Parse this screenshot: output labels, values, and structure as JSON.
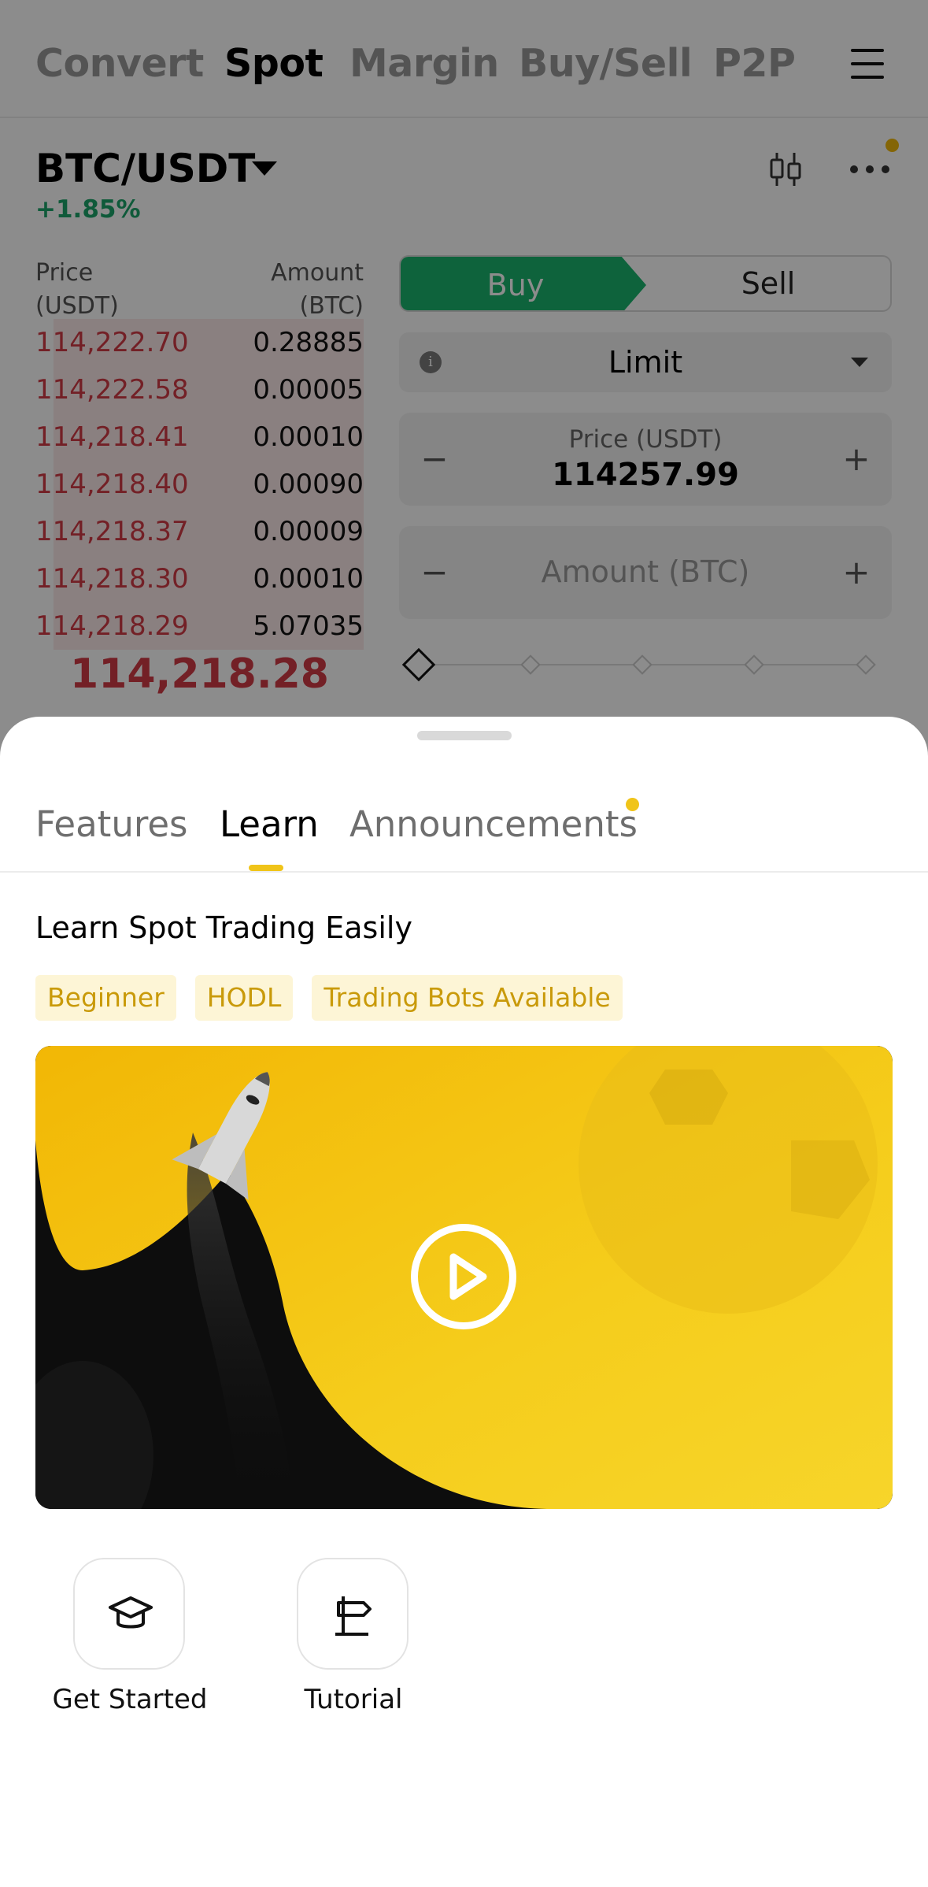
{
  "nav": {
    "tabs": [
      "Convert",
      "Spot",
      "Margin",
      "Buy/Sell",
      "P2P"
    ],
    "active": "Spot",
    "menu_icon": "hamburger-menu-icon"
  },
  "pair": {
    "symbol": "BTC/USDT",
    "change": "+1.85%"
  },
  "orderbook": {
    "price_header": "Price\n(USDT)",
    "amount_header": "Amount\n(BTC)",
    "price_header_line1": "Price",
    "price_header_line2": "(USDT)",
    "amount_header_line1": "Amount",
    "amount_header_line2": "(BTC)",
    "asks": [
      {
        "price": "114,222.70",
        "amount": "0.28885"
      },
      {
        "price": "114,222.58",
        "amount": "0.00005"
      },
      {
        "price": "114,218.41",
        "amount": "0.00010"
      },
      {
        "price": "114,218.40",
        "amount": "0.00090"
      },
      {
        "price": "114,218.37",
        "amount": "0.00009"
      },
      {
        "price": "114,218.30",
        "amount": "0.00010"
      },
      {
        "price": "114,218.29",
        "amount": "5.07035"
      }
    ],
    "last_price": "114,218.28"
  },
  "order_form": {
    "buy_label": "Buy",
    "sell_label": "Sell",
    "order_type": "Limit",
    "price_label": "Price (USDT)",
    "price_value": "114257.99",
    "amount_placeholder": "Amount (BTC)",
    "minus": "−",
    "plus": "+",
    "info_glyph": "i"
  },
  "sheet": {
    "tabs": [
      "Features",
      "Learn",
      "Announcements"
    ],
    "active_tab": "Learn",
    "title": "Learn Spot Trading Easily",
    "tags": [
      "Beginner",
      "HODL",
      "Trading Bots Available"
    ],
    "video_icon": "play-icon",
    "shortcuts": [
      {
        "label": "Get Started",
        "icon": "graduation-cap-icon"
      },
      {
        "label": "Tutorial",
        "icon": "signpost-icon"
      }
    ]
  },
  "colors": {
    "accent": "#f0c419",
    "buy": "#1ab56d",
    "sell_price": "#d23b45",
    "tag_text": "#c99a0a",
    "tag_bg": "#fdf5d6"
  }
}
